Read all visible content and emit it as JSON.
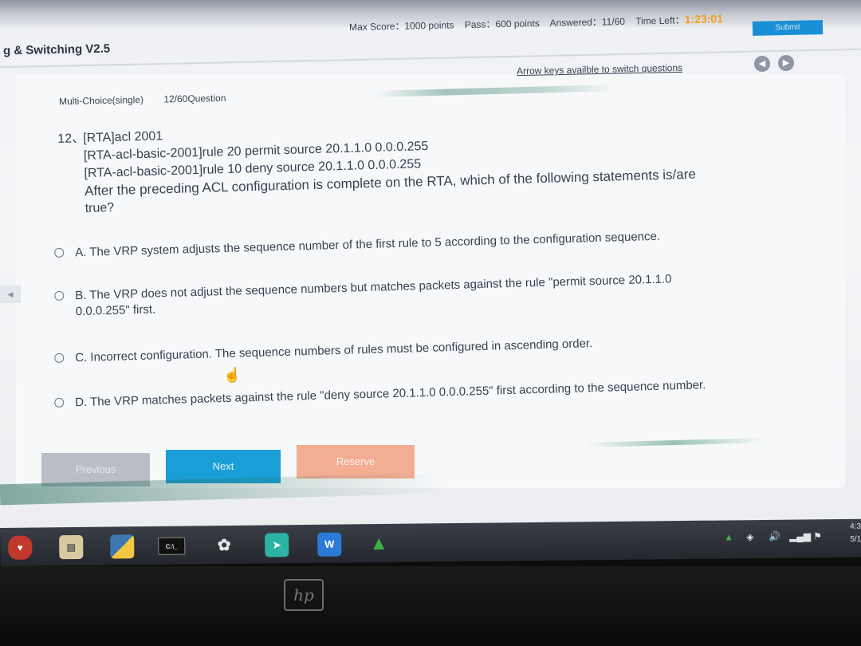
{
  "header": {
    "app_title": "g & Switching V2.5",
    "max_score": "Max Score：1000 points",
    "pass": "Pass：600 points",
    "answered": "Answered：11/60",
    "time_left_label": "Time Left：",
    "time_left_value": "1:23:01",
    "submit_label": "Submit"
  },
  "nav": {
    "arrow_hint": "Arrow keys availble to switch questions",
    "prev_icon": "chevron-left-icon",
    "next_icon": "chevron-right-icon"
  },
  "question": {
    "type": "Multi-Choice(single)",
    "progress": "12/60Question",
    "number": "12、",
    "lines": [
      "[RTA]acl 2001",
      "[RTA-acl-basic-2001]rule 20 permit source 20.1.1.0 0.0.0.255",
      "[RTA-acl-basic-2001]rule 10 deny source 20.1.1.0 0.0.0.255",
      "After the preceding ACL configuration is complete on the RTA, which of the following statements is/are",
      "true?"
    ]
  },
  "options": [
    {
      "label": "A. The VRP system adjusts the sequence number of the first rule to 5 according to the configuration sequence."
    },
    {
      "label": "B. The VRP does not adjust the sequence numbers but matches packets against the rule \"permit source 20.1.1.0",
      "label_cont": "0.0.0.255\" first."
    },
    {
      "label": "C. Incorrect configuration. The sequence numbers of rules must be configured in ascending order."
    },
    {
      "label": "D. The VRP matches packets against the rule \"deny source 20.1.1.0 0.0.0.255\" first according to the sequence number."
    }
  ],
  "buttons": {
    "previous": "Previous",
    "next": "Next",
    "reserve": "Reserve"
  },
  "taskbar": {
    "icons": [
      "app-shield-icon",
      "file-manager-icon",
      "python-icon",
      "terminal-icon",
      "network-tool-icon",
      "forward-arrow-icon",
      "word-icon",
      "drive-icon"
    ],
    "terminal_text": "C:\\_",
    "word_text": "W",
    "clock_time": "4:3",
    "clock_date": "5/1"
  },
  "bezel": {
    "brand": "hp"
  },
  "colors": {
    "time_accent": "#f2a015",
    "next_button": "#1a9ed7",
    "reserve_button": "#f3ad92",
    "previous_button": "#b9bec7",
    "submit_button": "#1a8fd6"
  }
}
